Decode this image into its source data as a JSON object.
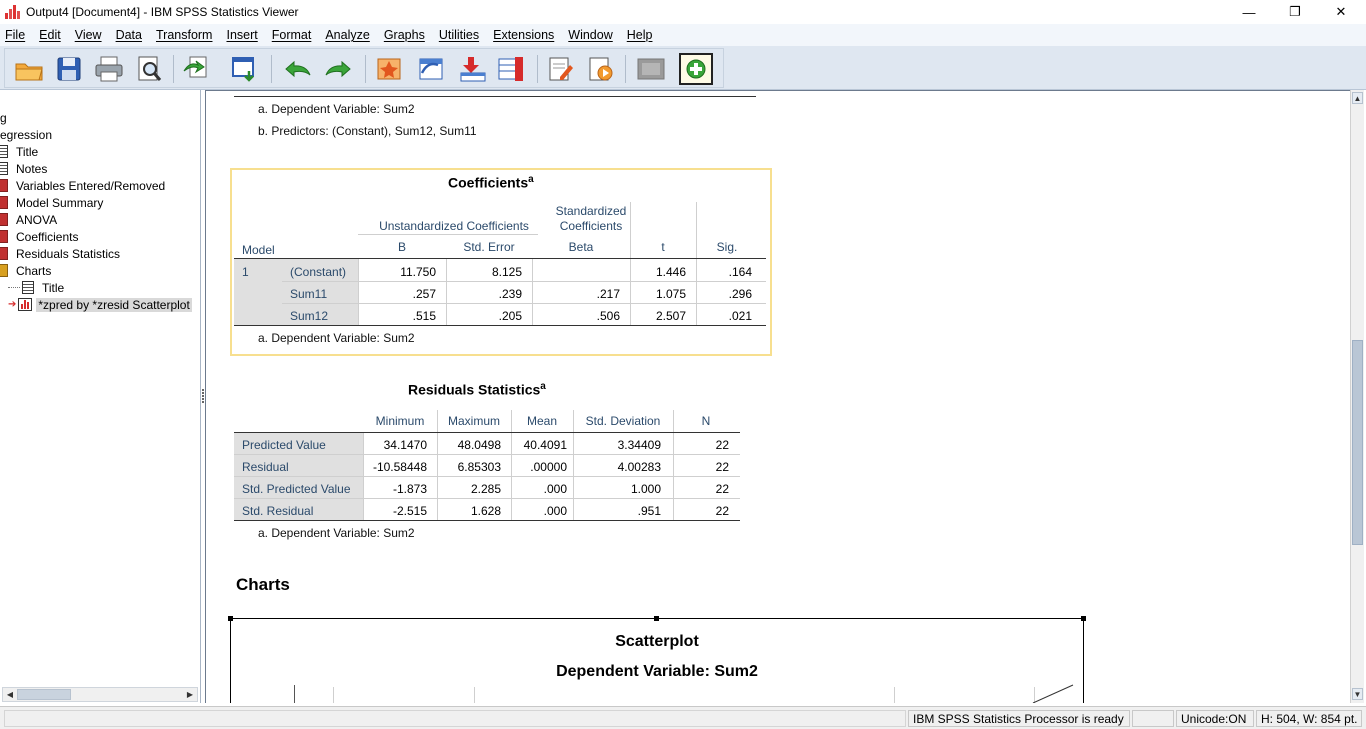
{
  "window": {
    "title": "Output4 [Document4] - IBM SPSS Statistics Viewer",
    "minimize": "—",
    "restore": "❐",
    "close": "✕"
  },
  "menu": [
    "File",
    "Edit",
    "View",
    "Data",
    "Transform",
    "Insert",
    "Format",
    "Analyze",
    "Graphs",
    "Utilities",
    "Extensions",
    "Window",
    "Help"
  ],
  "outline": {
    "items": [
      {
        "label": "g"
      },
      {
        "label": "egression"
      },
      {
        "label": "Title"
      },
      {
        "label": "Notes"
      },
      {
        "label": "Variables Entered/Removed"
      },
      {
        "label": "Model Summary"
      },
      {
        "label": "ANOVA"
      },
      {
        "label": "Coefficients"
      },
      {
        "label": "Residuals Statistics"
      },
      {
        "label": "Charts"
      },
      {
        "label": "Title"
      },
      {
        "label": "*zpred by *zresid Scatterplot"
      }
    ]
  },
  "prev_notes": {
    "a": "a. Dependent Variable: Sum2",
    "b": "b. Predictors: (Constant), Sum12, Sum11"
  },
  "coefficients": {
    "title": "Coefficients",
    "sup": "a",
    "hdr_unstd": "Unstandardized Coefficients",
    "hdr_std_1": "Standardized",
    "hdr_std_2": "Coefficients",
    "col_model": "Model",
    "col_b": "B",
    "col_se": "Std. Error",
    "col_beta": "Beta",
    "col_t": "t",
    "col_sig": "Sig.",
    "model_num": "1",
    "rows": [
      {
        "name": "(Constant)",
        "b": "11.750",
        "se": "8.125",
        "beta": "",
        "t": "1.446",
        "sig": ".164"
      },
      {
        "name": "Sum11",
        "b": ".257",
        "se": ".239",
        "beta": ".217",
        "t": "1.075",
        "sig": ".296"
      },
      {
        "name": "Sum12",
        "b": ".515",
        "se": ".205",
        "beta": ".506",
        "t": "2.507",
        "sig": ".021"
      }
    ],
    "note": "a. Dependent Variable: Sum2"
  },
  "residuals": {
    "title": "Residuals Statistics",
    "sup": "a",
    "cols": [
      "Minimum",
      "Maximum",
      "Mean",
      "Std. Deviation",
      "N"
    ],
    "rows": [
      {
        "name": "Predicted Value",
        "min": "34.1470",
        "max": "48.0498",
        "mean": "40.4091",
        "sd": "3.34409",
        "n": "22"
      },
      {
        "name": "Residual",
        "min": "-10.58448",
        "max": "6.85303",
        "mean": ".00000",
        "sd": "4.00283",
        "n": "22"
      },
      {
        "name": "Std. Predicted Value",
        "min": "-1.873",
        "max": "2.285",
        "mean": ".000",
        "sd": "1.000",
        "n": "22"
      },
      {
        "name": "Std. Residual",
        "min": "-2.515",
        "max": "1.628",
        "mean": ".000",
        "sd": ".951",
        "n": "22"
      }
    ],
    "note": "a. Dependent Variable: Sum2"
  },
  "charts": {
    "heading": "Charts",
    "title": "Scatterplot",
    "subtitle": "Dependent Variable: Sum2"
  },
  "status": {
    "processor": "IBM SPSS Statistics Processor is ready",
    "unicode": "Unicode:ON",
    "size": "H: 504, W: 854 pt."
  }
}
